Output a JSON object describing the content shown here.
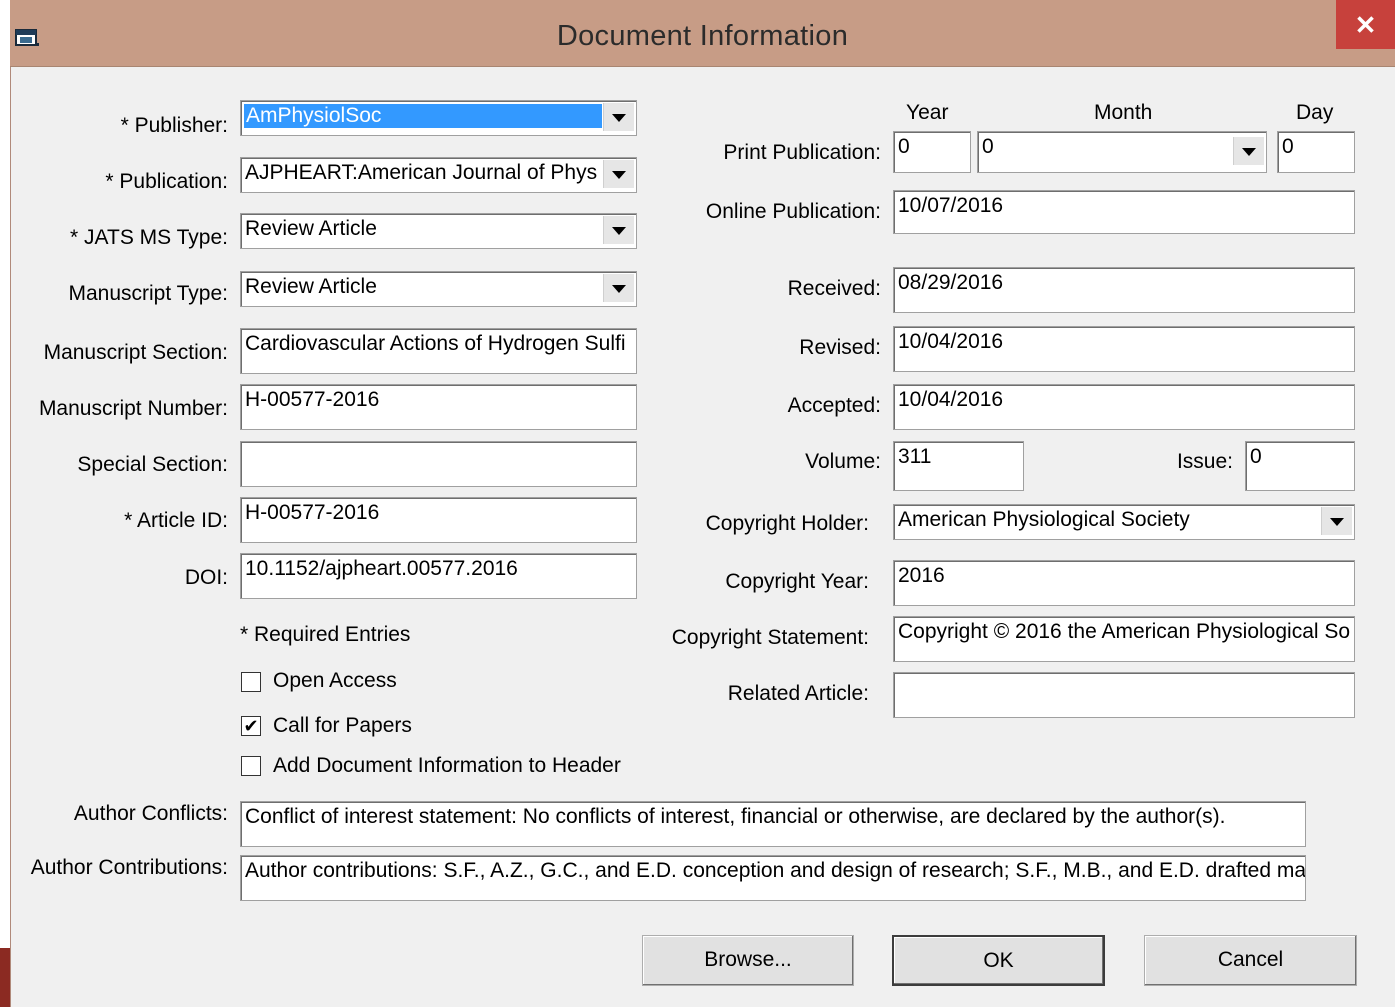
{
  "window": {
    "title": "Document Information",
    "close_glyph": "✕"
  },
  "left": {
    "publisher": {
      "label": "* Publisher:",
      "value": "AmPhysiolSoc"
    },
    "publication": {
      "label": "* Publication:",
      "value": "AJPHEART:American Journal of Phys"
    },
    "jats_ms_type": {
      "label": "* JATS MS Type:",
      "value": "Review Article"
    },
    "manuscript_type": {
      "label": "Manuscript Type:",
      "value": "Review Article"
    },
    "manuscript_section": {
      "label": "Manuscript Section:",
      "value": "Cardiovascular Actions of Hydrogen Sulfi"
    },
    "manuscript_number": {
      "label": "Manuscript Number:",
      "value": "H-00577-2016"
    },
    "special_section": {
      "label": "Special Section:",
      "value": ""
    },
    "article_id": {
      "label": "* Article ID:",
      "value": "H-00577-2016"
    },
    "doi": {
      "label": "DOI:",
      "value": "10.1152/ajpheart.00577.2016"
    },
    "required_note": "* Required Entries",
    "open_access": {
      "label": "Open Access",
      "checked": false
    },
    "call_for_papers": {
      "label": "Call for Papers",
      "checked": true
    },
    "add_doc_info": {
      "label": "Add Document Information to Header",
      "checked": false
    }
  },
  "right": {
    "col_year": "Year",
    "col_month": "Month",
    "col_day": "Day",
    "print_publication": {
      "label": "Print Publication:",
      "year": "0",
      "month": "0",
      "day": "0"
    },
    "online_publication": {
      "label": "Online Publication:",
      "value": "10/07/2016"
    },
    "received": {
      "label": "Received:",
      "value": "08/29/2016"
    },
    "revised": {
      "label": "Revised:",
      "value": "10/04/2016"
    },
    "accepted": {
      "label": "Accepted:",
      "value": "10/04/2016"
    },
    "volume": {
      "label": "Volume:",
      "value": "311"
    },
    "issue": {
      "label": "Issue:",
      "value": "0"
    },
    "copyright_holder": {
      "label": "Copyright Holder:",
      "value": "American Physiological Society"
    },
    "copyright_year": {
      "label": "Copyright Year:",
      "value": "2016"
    },
    "copyright_statement": {
      "label": "Copyright Statement:",
      "value": "Copyright © 2016 the American Physiological So"
    },
    "related_article": {
      "label": "Related Article:",
      "value": ""
    }
  },
  "bottom": {
    "author_conflicts": {
      "label": "Author Conflicts:",
      "value": "Conflict of interest statement:  No conflicts of interest, financial or otherwise, are declared by the author(s)."
    },
    "author_contributions": {
      "label": "Author Contributions:",
      "value": "Author contributions:  S.F., A.Z., G.C., and E.D. conception and design of research;  S.F., M.B., and E.D. drafted ma"
    }
  },
  "buttons": {
    "browse": "Browse...",
    "ok": "OK",
    "cancel": "Cancel"
  }
}
